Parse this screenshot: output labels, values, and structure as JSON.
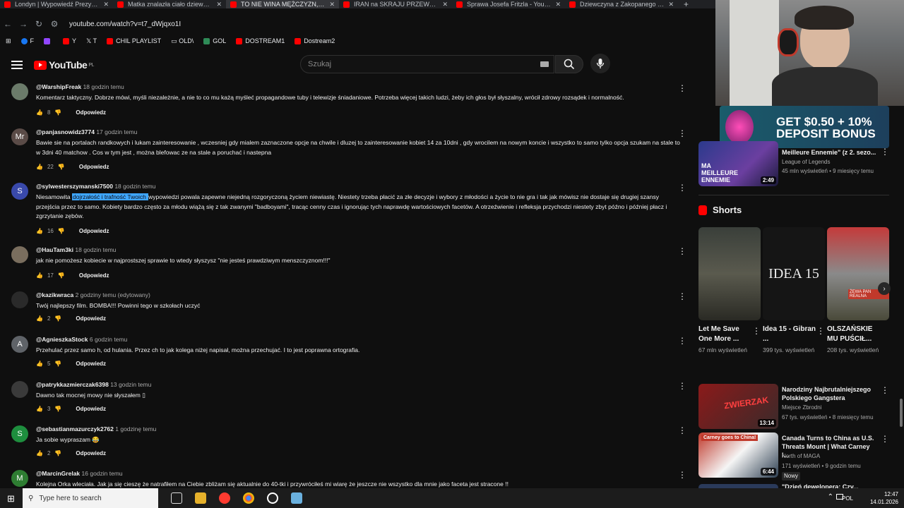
{
  "browser": {
    "tabs": [
      {
        "label": "Londyn | Wypowiedź Prezydent"
      },
      {
        "label": "Matka znalazła ciało dziewczyn"
      },
      {
        "label": "TO NIE WINA MĘŻCZYZN, ŻE P"
      },
      {
        "label": "IRAN na SKRAJU PRZEWROTU"
      },
      {
        "label": "Sprawa Josefa Fritzla - YouTube"
      },
      {
        "label": "Dziewczyna z Zakopanego zagi"
      }
    ],
    "url": "youtube.com/watch?v=t7_dWjqxo1I",
    "bookmarks": [
      "F",
      "",
      "Y",
      "T",
      "CHIL PLAYLIST",
      "OLD\\",
      "GOL",
      "DOSTREAM1",
      "Dostream2"
    ]
  },
  "youtube": {
    "logo": "YouTube",
    "region": "PL",
    "search_placeholder": "Szukaj"
  },
  "comments": [
    {
      "author": "@WarshipFreak",
      "time": "18 godzin temu",
      "text": "Komentarz taktyczny. Dobrze mówi, myśli niezależnie, a nie to co mu każą myśleć propagandowe tuby i telewizje śniadaniowe. Potrzeba więcej takich ludzi, żeby ich głos był słyszalny, wrócił zdrowy rozsądek i normalność.",
      "likes": "8",
      "reply": "Odpowiedz",
      "avatar": "",
      "avatar_color": "#6b7b6a"
    },
    {
      "author": "@panjasnowidz3774",
      "time": "17 godzin temu",
      "text": "Bawie sie na portalach randkowych i lukam zainteresowanie , wczesniej gdy mialem zaznaczone opcje na chwile i dluzej to zainteresowanie kobiet 14 za 10dni , gdy wrocilem na nowym koncie i wszystko to samo tylko opcja szukam na stale to w 3dni 40 matchow . Cos w tym jest , można blefowac ze na stale a poruchać i nastepna",
      "likes": "22",
      "reply": "Odpowiedz",
      "avatar": "Mr",
      "avatar_color": "#5a4b47"
    },
    {
      "author": "@sylwesterszymanski7500",
      "time": "18 godzin temu",
      "text_before": "Niesamowita ",
      "text_highlight": "dojrzałość i trafność Twoich ",
      "text_after": "wypowiedzi powala zapewne niejedną rozgoryczoną życiem niewiastę. Niestety trzeba płacić za złe decyzje i wybory z młodości a życie to nie gra i tak jak mówisz nie dostaje się drugiej szansy przejścia przez to samo. Kobiety bardzo często za młodu wiążą się z tak zwanymi \"badboyami\", tracąc cenny czas i ignorując tych naprawdę wartościowych facetów. A otrzeźwienie i refleksja przychodzi niestety zbyt późno i później płacz i zgrzytanie zębów.",
      "likes": "16",
      "reply": "Odpowiedz",
      "avatar": "S",
      "avatar_color": "#3949ab"
    },
    {
      "author": "@HauTam3ki",
      "time": "18 godzin temu",
      "text": "jak nie pomożesz kobiecie w najprostszej sprawie to wtedy słyszysz \"nie jesteś prawdziwym menszczyznom!!!\"",
      "likes": "17",
      "reply": "Odpowiedz",
      "avatar": "",
      "avatar_color": "#7a6e5e"
    },
    {
      "author": "@kazikwraca",
      "time": "2 godziny temu (edytowany)",
      "text": "Twój najlepszy film. BOMBA!!! Powinni tego w szkołach uczyć",
      "likes": "2",
      "reply": "Odpowiedz",
      "avatar": "",
      "avatar_color": "#2a2a2a"
    },
    {
      "author": "@AgnieszkaStock",
      "time": "6 godzin temu",
      "text": "Przehulać przez samo h, od hulania. Przez ch to jak kolega niżej napisał, można przechujać. I to jest poprawna ortografia.",
      "likes": "5",
      "reply": "Odpowiedz",
      "avatar": "A",
      "avatar_color": "#5f6368"
    },
    {
      "author": "@patrykkazmierczak6398",
      "time": "13 godzin temu",
      "text": "Dawno tak mocnej mowy nie słyszałem ▯",
      "likes": "3",
      "reply": "Odpowiedz",
      "avatar": "",
      "avatar_color": "#3a3a3a"
    },
    {
      "author": "@sebastianmazurczyk2762",
      "time": "1 godzinę temu",
      "text": "Ja sobie wypraszam 😂",
      "likes": "2",
      "reply": "Odpowiedz",
      "avatar": "S",
      "avatar_color": "#1e8e3e"
    },
    {
      "author": "@MarcinGrelak",
      "time": "16 godzin temu",
      "text": "Kolejna Orka wleciała. Jak ja się cieszę że natrafiłem na Ciebie zbliżam się aktualnie do 40-tki i przywróciłeś mi wiarę że jeszcze nie wszystko dla mnie jako faceta jest stracone !!",
      "likes": "",
      "reply": "",
      "avatar": "M",
      "avatar_color": "#2e7d32"
    }
  ],
  "sidebar": {
    "ad": {
      "line1": "GET $0.50 + 10%",
      "line2": "DEPOSIT BONUS"
    },
    "top_video": {
      "title": "Meilleure Ennemie\" (z 2. sezo...",
      "channel": "League of Legends",
      "meta": "45 mln wyświetleń • 9 miesięcy temu",
      "duration": "2:49",
      "thumb_text": "MA MEILLEURE ENNEMIE"
    },
    "shorts_title": "Shorts",
    "shorts": [
      {
        "title": "Let Me Save One More ...",
        "views": "67 mln wyświetleń",
        "thumb": ""
      },
      {
        "title": "Idea 15 - Gibran ...",
        "views": "399 tys. wyświetleń",
        "thumb": "IDEA 15"
      },
      {
        "title": "OLSZAŃSKIE MU PUŚCIŁ...",
        "views": "208 tys. wyświetleń",
        "thumb": "ŻEWA PAN REALNA"
      }
    ],
    "videos": [
      {
        "title": "Narodziny Najbrutalniejszego Polskiego Gangstera",
        "channel": "Miejsce Zbrodni",
        "meta": "67 tys. wyświetleń • 8 miesięcy temu",
        "duration": "13:14",
        "thumb_text": "ZWIERZAK",
        "badge": ""
      },
      {
        "title": "Canada Turns to China as U.S. Threats Mount | What Carney I...",
        "channel": "North of MAGA",
        "meta": "171 wyświetleń • 9 godzin temu",
        "duration": "6:44",
        "thumb_text": "Carney goes to China!",
        "badge": "Nowy"
      },
      {
        "title": "\"Dzień dewelopera: Czy...",
        "channel": "",
        "meta": "",
        "duration": "",
        "thumb_text": "",
        "badge": ""
      }
    ]
  },
  "taskbar": {
    "search_placeholder": "Type here to search",
    "lang": "POL",
    "time": "12:47",
    "date": "14.01.2026"
  }
}
